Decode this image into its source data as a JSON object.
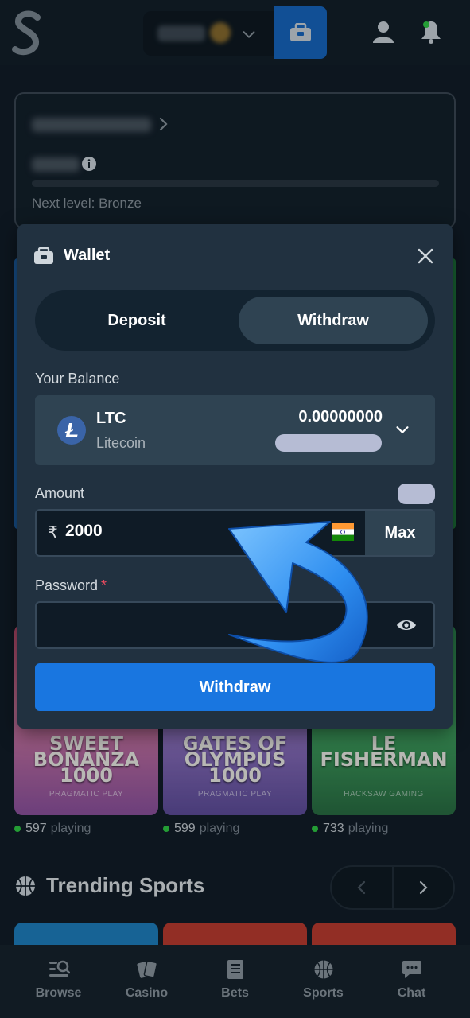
{
  "level_card": {
    "next_level": "Next level: Bronze"
  },
  "modal": {
    "title": "Wallet",
    "tabs": [
      {
        "label": "Deposit",
        "active": false
      },
      {
        "label": "Withdraw",
        "active": true
      }
    ],
    "balance_label": "Your Balance",
    "currency": {
      "code": "LTC",
      "name": "Litecoin",
      "amount": "0.00000000"
    },
    "amount_label": "Amount",
    "amount_symbol": "₹",
    "amount_value": "2000",
    "max_label": "Max",
    "password_label": "Password",
    "password_required": "*",
    "submit_label": "Withdraw"
  },
  "games": [
    {
      "title": "SWEET BONANZA 1000",
      "provider": "PRAGMATIC PLAY",
      "players": "597",
      "playing_label": "playing"
    },
    {
      "title": "GATES OF OLYMPUS 1000",
      "provider": "PRAGMATIC PLAY",
      "players": "599",
      "playing_label": "playing"
    },
    {
      "title": "LE FISHERMAN",
      "provider": "HACKSAW GAMING",
      "players": "733",
      "playing_label": "playing"
    }
  ],
  "trending": {
    "title": "Trending Sports"
  },
  "bottom_nav": [
    {
      "label": "Browse",
      "icon": "browse-icon"
    },
    {
      "label": "Casino",
      "icon": "cards-icon"
    },
    {
      "label": "Bets",
      "icon": "betslip-icon"
    },
    {
      "label": "Sports",
      "icon": "basketball-icon"
    },
    {
      "label": "Chat",
      "icon": "chat-icon"
    }
  ],
  "colors": {
    "background": "#0f1923",
    "modal": "#213140",
    "accent_blue": "#1976e0",
    "online_dot": "#2ecc40",
    "required": "#e84a5f"
  }
}
